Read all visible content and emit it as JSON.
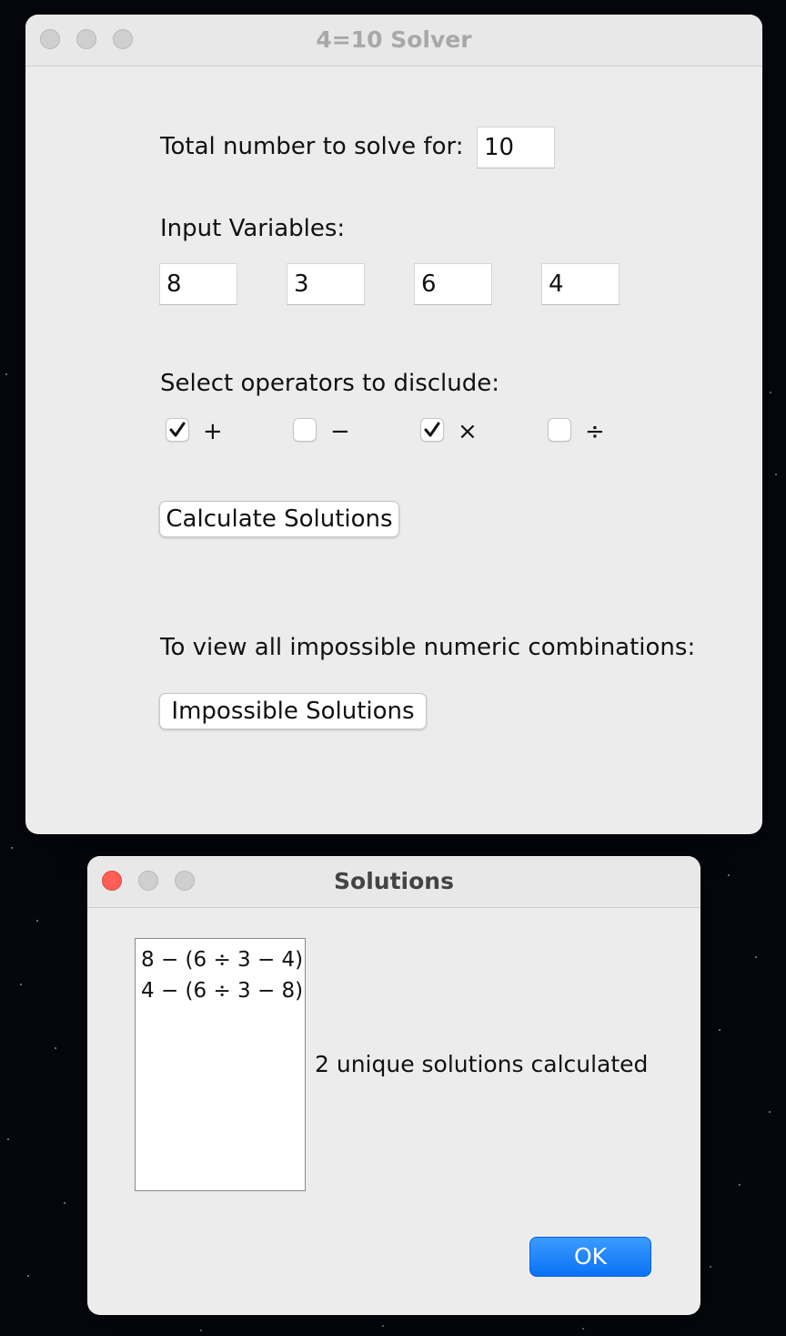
{
  "main_window": {
    "title": "4=10 Solver",
    "target_label": "Total number to solve for:",
    "target_value": "10",
    "variables_label": "Input Variables:",
    "variables": [
      "8",
      "3",
      "6",
      "4"
    ],
    "operators_label": "Select operators to disclude:",
    "operators": [
      {
        "symbol": "+",
        "checked": true
      },
      {
        "symbol": "−",
        "checked": false
      },
      {
        "symbol": "×",
        "checked": true
      },
      {
        "symbol": "÷",
        "checked": false
      }
    ],
    "calculate_label": "Calculate Solutions",
    "impossible_prompt": "To view all impossible numeric combinations:",
    "impossible_label": "Impossible Solutions"
  },
  "solutions_window": {
    "title": "Solutions",
    "solutions": [
      "8 − (6 ÷ 3 − 4)",
      "4 − (6 ÷ 3 − 8)"
    ],
    "summary": "2 unique solutions calculated",
    "ok_label": "OK"
  },
  "colors": {
    "window_bg": "#ececec",
    "ok_button": "#0a72f5",
    "close_light": "#fe5f57"
  }
}
